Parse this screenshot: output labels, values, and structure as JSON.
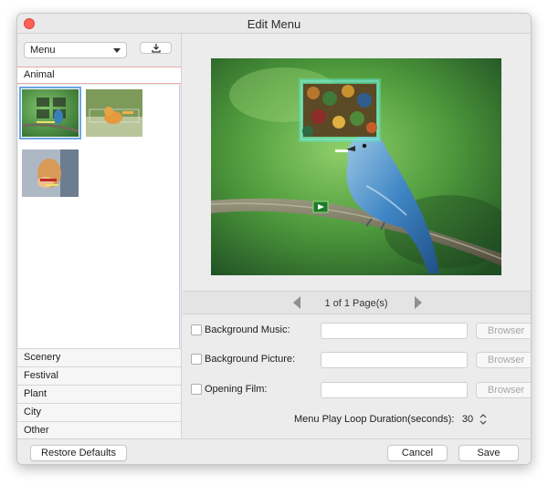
{
  "window": {
    "title": "Edit Menu"
  },
  "sidebar": {
    "menu_select": "Menu",
    "active_category": "Animal",
    "categories": [
      "Scenery",
      "Festival",
      "Plant",
      "City",
      "Other"
    ]
  },
  "pager": {
    "text": "1 of 1 Page(s)"
  },
  "options": {
    "background_music": {
      "label": "Background Music:",
      "value": "",
      "browse": "Browser"
    },
    "background_picture": {
      "label": "Background Picture:",
      "value": "",
      "browse": "Browser"
    },
    "opening_film": {
      "label": "Opening Film:",
      "value": "",
      "browse": "Browser"
    },
    "loop": {
      "label": "Menu Play Loop Duration(seconds):",
      "value": "30"
    }
  },
  "footer": {
    "restore": "Restore Defaults",
    "cancel": "Cancel",
    "save": "Save"
  },
  "colors": {
    "close": "#fe5f57",
    "selection": "#6aa6e8",
    "frame_glow": "#5fe0c8"
  },
  "icons": [
    "close-icon",
    "download-icon",
    "caret-down-icon",
    "prev-page-icon",
    "next-page-icon",
    "play-icon",
    "stepper-icon"
  ]
}
